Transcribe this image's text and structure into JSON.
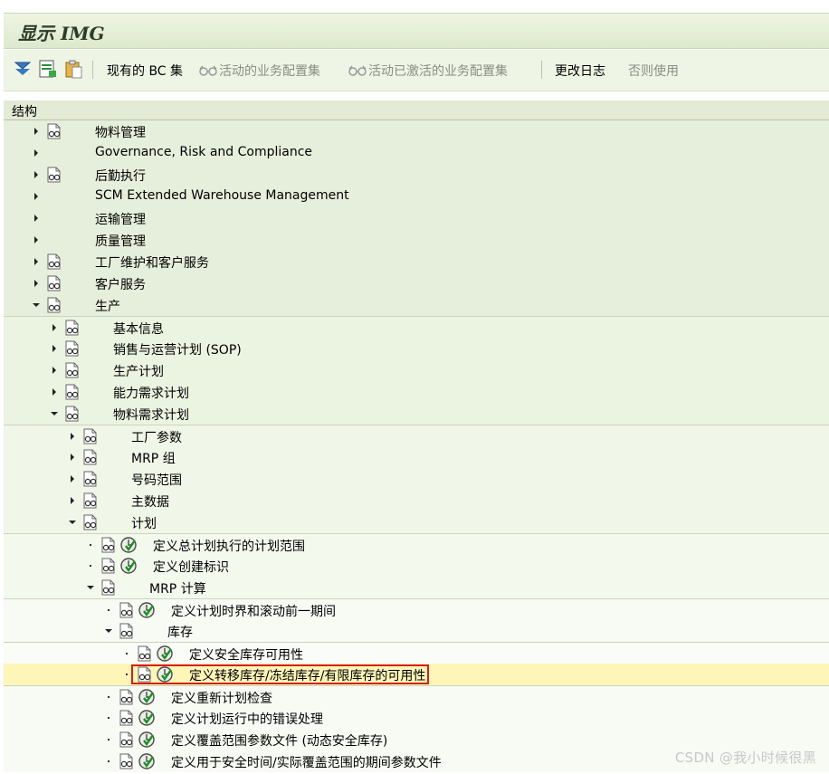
{
  "title": "显示 IMG",
  "toolbar": {
    "items": [
      {
        "label": "现有的 BC 集",
        "disabled": false
      },
      {
        "label": "活动的业务配置集",
        "disabled": true
      },
      {
        "label": "活动已激活的业务配置集",
        "disabled": true
      },
      {
        "label": "更改日志",
        "disabled": false
      },
      {
        "label": "否则使用",
        "disabled": true
      }
    ]
  },
  "column_header": "结构",
  "tree": [
    {
      "label": "物料管理",
      "level": 0,
      "expander": "collapsed",
      "doc": true,
      "activity": false,
      "bg": 0
    },
    {
      "label": "Governance, Risk and Compliance",
      "level": 0,
      "expander": "collapsed",
      "doc": false,
      "activity": false,
      "bg": 0
    },
    {
      "label": "后勤执行",
      "level": 0,
      "expander": "collapsed",
      "doc": true,
      "activity": false,
      "bg": 0
    },
    {
      "label": "SCM Extended Warehouse Management",
      "level": 0,
      "expander": "collapsed",
      "doc": false,
      "activity": false,
      "bg": 0
    },
    {
      "label": "运输管理",
      "level": 0,
      "expander": "collapsed",
      "doc": false,
      "activity": false,
      "bg": 0
    },
    {
      "label": "质量管理",
      "level": 0,
      "expander": "collapsed",
      "doc": false,
      "activity": false,
      "bg": 0
    },
    {
      "label": "工厂维护和客户服务",
      "level": 0,
      "expander": "collapsed",
      "doc": true,
      "activity": false,
      "bg": 0
    },
    {
      "label": "客户服务",
      "level": 0,
      "expander": "collapsed",
      "doc": true,
      "activity": false,
      "bg": 0
    },
    {
      "label": "生产",
      "level": 0,
      "expander": "expanded",
      "doc": true,
      "activity": false,
      "bg": 0
    },
    {
      "label": "基本信息",
      "level": 1,
      "expander": "collapsed",
      "doc": true,
      "activity": false,
      "bg": 1
    },
    {
      "label": "销售与运营计划 (SOP)",
      "level": 1,
      "expander": "collapsed",
      "doc": true,
      "activity": false,
      "bg": 1
    },
    {
      "label": "生产计划",
      "level": 1,
      "expander": "collapsed",
      "doc": true,
      "activity": false,
      "bg": 1
    },
    {
      "label": "能力需求计划",
      "level": 1,
      "expander": "collapsed",
      "doc": true,
      "activity": false,
      "bg": 1
    },
    {
      "label": "物料需求计划",
      "level": 1,
      "expander": "expanded",
      "doc": true,
      "activity": false,
      "bg": 1
    },
    {
      "label": "工厂参数",
      "level": 2,
      "expander": "collapsed",
      "doc": true,
      "activity": false,
      "bg": 2
    },
    {
      "label": "MRP 组",
      "level": 2,
      "expander": "collapsed",
      "doc": true,
      "activity": false,
      "bg": 2
    },
    {
      "label": "号码范围",
      "level": 2,
      "expander": "collapsed",
      "doc": true,
      "activity": false,
      "bg": 2
    },
    {
      "label": "主数据",
      "level": 2,
      "expander": "collapsed",
      "doc": true,
      "activity": false,
      "bg": 2
    },
    {
      "label": "计划",
      "level": 2,
      "expander": "expanded",
      "doc": true,
      "activity": false,
      "bg": 2
    },
    {
      "label": "定义总计划执行的计划范围",
      "level": 3,
      "expander": "leaf",
      "doc": true,
      "activity": true,
      "bg": 3
    },
    {
      "label": "定义创建标识",
      "level": 3,
      "expander": "leaf",
      "doc": true,
      "activity": true,
      "bg": 3
    },
    {
      "label": "MRP 计算",
      "level": 3,
      "expander": "expanded",
      "doc": true,
      "activity": false,
      "bg": 3
    },
    {
      "label": "定义计划时界和滚动前一期间",
      "level": 4,
      "expander": "leaf",
      "doc": true,
      "activity": true,
      "bg": 4
    },
    {
      "label": "库存",
      "level": 4,
      "expander": "expanded",
      "doc": true,
      "activity": false,
      "bg": 4
    },
    {
      "label": "定义安全库存可用性",
      "level": 5,
      "expander": "leaf",
      "doc": true,
      "activity": true,
      "bg": 5
    },
    {
      "label": "定义转移库存/冻结库存/有限库存的可用性",
      "level": 5,
      "expander": "leaf",
      "doc": true,
      "activity": true,
      "bg": 5,
      "selected": true
    },
    {
      "label": "定义重新计划检查",
      "level": 4,
      "expander": "leaf",
      "doc": true,
      "activity": true,
      "bg": 4
    },
    {
      "label": "定义计划运行中的错误处理",
      "level": 4,
      "expander": "leaf",
      "doc": true,
      "activity": true,
      "bg": 4
    },
    {
      "label": "定义覆盖范围参数文件 (动态安全库存)",
      "level": 4,
      "expander": "leaf",
      "doc": true,
      "activity": true,
      "bg": 4
    },
    {
      "label": "定义用于安全时间/实际覆盖范围的期间参数文件",
      "level": 4,
      "expander": "leaf",
      "doc": true,
      "activity": true,
      "bg": 4
    }
  ],
  "watermark": "CSDN @我小时候很黑"
}
